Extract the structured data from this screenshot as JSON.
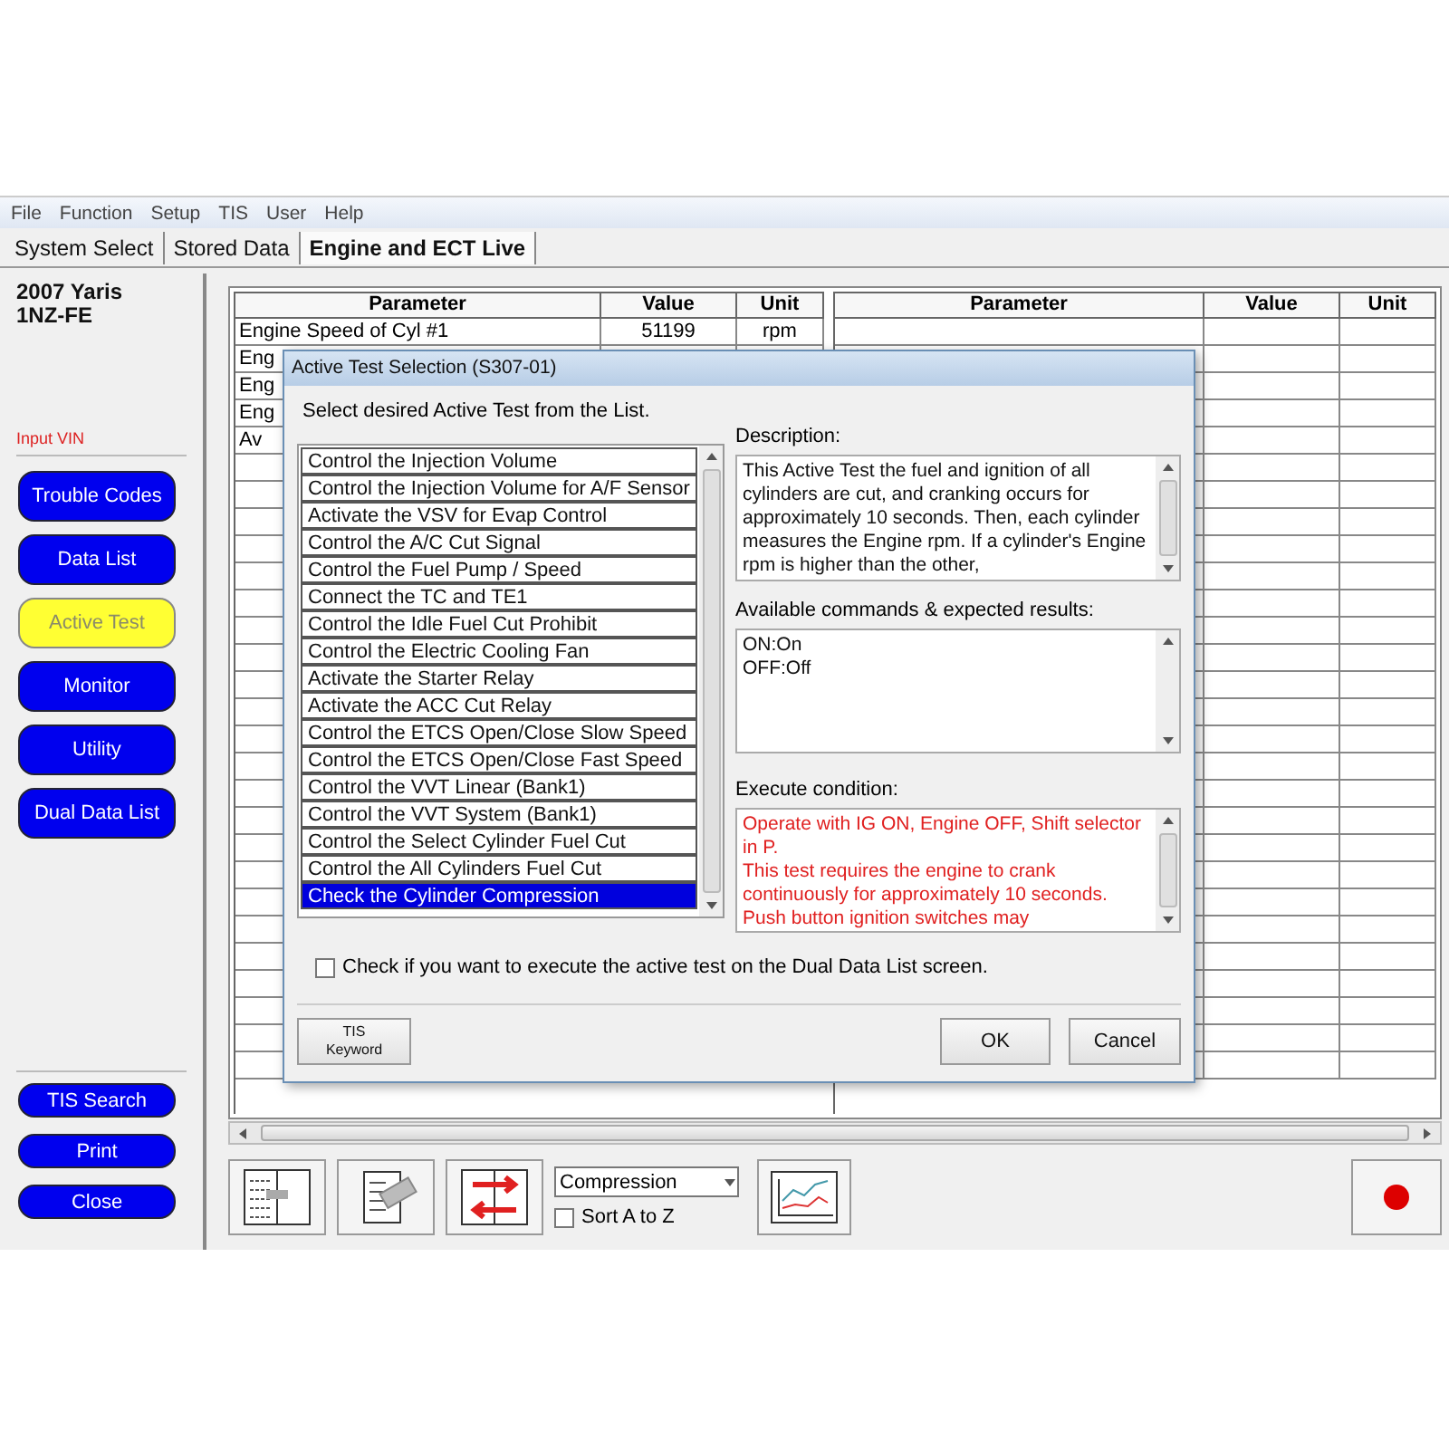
{
  "menu": [
    "File",
    "Function",
    "Setup",
    "TIS",
    "User",
    "Help"
  ],
  "tabs": [
    {
      "label": "System Select",
      "selected": false
    },
    {
      "label": "Stored Data",
      "selected": false
    },
    {
      "label": "Engine and ECT Live",
      "selected": true
    }
  ],
  "vehicle": {
    "model": "2007 Yaris",
    "engine": "1NZ-FE"
  },
  "input_vin": "Input VIN",
  "nav_buttons": [
    {
      "label": "Trouble Codes",
      "selected": false
    },
    {
      "label": "Data List",
      "selected": false
    },
    {
      "label": "Active Test",
      "selected": true
    },
    {
      "label": "Monitor",
      "selected": false
    },
    {
      "label": "Utility",
      "selected": false
    },
    {
      "label": "Dual Data List",
      "selected": false
    }
  ],
  "bottom_buttons": [
    "TIS Search",
    "Print",
    "Close"
  ],
  "table": {
    "columns": [
      "Parameter",
      "Value",
      "Unit"
    ],
    "rows": [
      {
        "parameter": "Engine Speed of Cyl #1",
        "value": "51199",
        "unit": "rpm"
      },
      {
        "parameter": "Eng"
      },
      {
        "parameter": "Eng"
      },
      {
        "parameter": "Eng"
      },
      {
        "parameter": "Av"
      }
    ]
  },
  "table_right": {
    "columns": [
      "Parameter",
      "Value",
      "Unit"
    ]
  },
  "dialog": {
    "title": "Active Test Selection (S307-01)",
    "prompt": "Select desired Active Test from the List.",
    "tests": [
      {
        "label": "Control the Injection Volume",
        "selected": false
      },
      {
        "label": "Control the Injection Volume for A/F Sensor",
        "selected": false
      },
      {
        "label": "Activate the VSV for Evap Control",
        "selected": false
      },
      {
        "label": "Control the A/C Cut Signal",
        "selected": false
      },
      {
        "label": "Control the Fuel Pump / Speed",
        "selected": false
      },
      {
        "label": "Connect the TC and TE1",
        "selected": false
      },
      {
        "label": "Control the Idle Fuel Cut Prohibit",
        "selected": false
      },
      {
        "label": "Control the Electric Cooling Fan",
        "selected": false
      },
      {
        "label": "Activate the Starter Relay",
        "selected": false
      },
      {
        "label": "Activate the ACC Cut Relay",
        "selected": false
      },
      {
        "label": "Control the ETCS Open/Close Slow Speed",
        "selected": false
      },
      {
        "label": "Control the ETCS Open/Close Fast Speed",
        "selected": false
      },
      {
        "label": "Control the VVT Linear (Bank1)",
        "selected": false
      },
      {
        "label": "Control the VVT System (Bank1)",
        "selected": false
      },
      {
        "label": "Control the Select Cylinder Fuel Cut",
        "selected": false
      },
      {
        "label": "Control the All Cylinders Fuel Cut",
        "selected": false
      },
      {
        "label": "Check the Cylinder Compression",
        "selected": true
      }
    ],
    "description_label": "Description:",
    "description": "This Active Test the fuel and ignition of all cylinders are cut, and cranking occurs for approximately 10 seconds. Then, each cylinder measures the Engine rpm. If a cylinder's Engine rpm is higher than the other,",
    "commands_label": "Available commands & expected results:",
    "commands": [
      "ON:On",
      "OFF:Off"
    ],
    "condition_label": "Execute condition:",
    "condition": [
      "Operate with IG ON, Engine OFF, Shift selector in P.",
      "This test requires the engine to crank continuously for approximately 10 seconds.  Push button ignition switches may"
    ],
    "dual_checkbox": {
      "label": "Check if you want to execute the active test on the Dual Data List screen.",
      "checked": false
    },
    "keyword_button": [
      "TIS",
      "Keyword"
    ],
    "ok": "OK",
    "cancel": "Cancel"
  },
  "toolbar": {
    "select": "Compression",
    "sort": {
      "label": "Sort A to Z",
      "checked": false
    }
  }
}
